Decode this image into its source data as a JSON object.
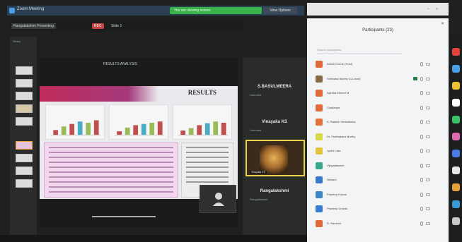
{
  "window": {
    "app_title": "Zoom Meeting",
    "sharing_banner": "You are viewing screen",
    "stop_share": "View Options"
  },
  "meeting_tabs": [
    {
      "label": "Rangalakshmi Presenting",
      "active": true
    },
    {
      "label": "REC",
      "type": "rec"
    },
    {
      "label": "Slide 1"
    }
  ],
  "slides_panel": {
    "label": "Slides"
  },
  "slide": {
    "header_text": "RESULTS ANALYSIS",
    "title": "RESULTS",
    "charts": [
      {
        "bars": [
          0.2,
          0.35,
          0.45,
          0.55,
          0.5,
          0.6
        ]
      },
      {
        "bars": [
          0.15,
          0.3,
          0.4,
          0.45,
          0.5,
          0.55
        ]
      },
      {
        "bars": [
          0.18,
          0.28,
          0.4,
          0.48,
          0.55,
          0.5
        ]
      }
    ]
  },
  "video_tiles": [
    {
      "name": "S.BASULMEERA",
      "sub": "Unmuted"
    },
    {
      "name": "Vinayaka KS",
      "sub": "Unmuted"
    },
    {
      "name": "Rangalakshmi",
      "sub": "Rangalakshmi"
    }
  ],
  "participants": {
    "title": "Participants (23)",
    "search_placeholder": "Search participants",
    "rows": [
      {
        "name": "Ashok Kumar (Host)",
        "color": "#e06a3a"
      },
      {
        "name": "Srinivasa Murthy (Co-host)",
        "color": "#8a6a4a",
        "hand": true
      },
      {
        "name": "Ayesha Ahmed M",
        "color": "#e26b3b"
      },
      {
        "name": "Chaitanya",
        "color": "#e56a3a"
      },
      {
        "name": "K. Rakesh Venkatesha",
        "color": "#e3713a"
      },
      {
        "name": "Dr. Prabhakara Murthy",
        "color": "#d7da46"
      },
      {
        "name": "Jyothi Lata",
        "color": "#e2c53a"
      },
      {
        "name": "Vijayalakshmi",
        "color": "#3aa88a"
      },
      {
        "name": "Nishant",
        "color": "#3a78c8"
      },
      {
        "name": "Pradeep Kumar",
        "color": "#3a86c9"
      },
      {
        "name": "Pradeep Gowda",
        "color": "#3a7ad0"
      },
      {
        "name": "R. Ramesh",
        "color": "#e06a3a"
      }
    ]
  },
  "dock_apps": [
    {
      "color": "#e8433a"
    },
    {
      "color": "#4aa0e6"
    },
    {
      "color": "#f0c030"
    },
    {
      "color": "#ffffff"
    },
    {
      "color": "#3ac46a"
    },
    {
      "color": "#e06ab0"
    },
    {
      "color": "#4a7ae6"
    },
    {
      "color": "#e8e8e8"
    },
    {
      "color": "#e6a23a"
    },
    {
      "color": "#3a9ad8"
    },
    {
      "color": "#c8c8c8"
    }
  ]
}
